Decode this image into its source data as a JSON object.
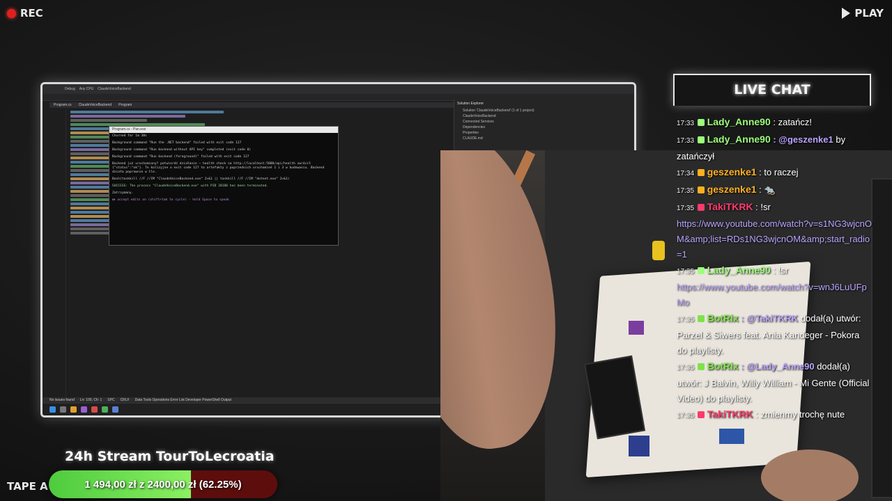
{
  "overlay": {
    "rec": "REC",
    "play": "PLAY",
    "tape": "TAPE A"
  },
  "stream": {
    "title": "24h Stream TourToLecroatia",
    "goal_text": "1 494,00 zł z 2400,00 zł (62.25%)",
    "goal_fraction": 0.6225
  },
  "ide": {
    "titlebar": [
      "Debug",
      "Any CPU",
      "ClaudeVoiceBackend"
    ],
    "tabs": [
      "Program.cs",
      "ClaudeVoiceBackend",
      "Program"
    ],
    "solution_header": "Solution Explorer",
    "solution_items": [
      "Solution 'ClaudeVoiceBackend' (1 of 1 project)",
      "ClaudeVoiceBackend",
      "Connected Services",
      "Dependencies",
      "Properties",
      "CLAUDE.md"
    ],
    "statusbar": [
      "No issues found",
      "Ln: 100, Ch: 1",
      "SPC",
      "CRLF"
    ],
    "bottom_tabs": "Data Tools Operations  Error List  Developer PowerShell  Output",
    "terminal": {
      "title": "Program.cs - Pan.exe",
      "lines": [
        "Churned for 1m 38s",
        "Background command \"Run the .NET backend\" failed with exit code 127",
        "Background command \"Run backend without API key\" completed (exit code 0)",
        "Background command \"Run backend (foreground)\" failed with exit code 127",
        "Backend już uruchomiony? potwierdź działanie — health check na http://localhost:5000/api/health zwrócił {\"status\":\"ok\"}. Te kolizyjne o exit code 127 to artefakty z poprzednich uruchomień 1 i 3 w budowaniu. Backend działa poprawnie w tle.",
        "Bash(taskkill //F //IM \"ClaudeVoiceBackend.exe\" 2>&1 || taskkill //F //IM \"dotnet.exe\" 2>&1)",
        "SUCCESS: The process \"ClaudeVoiceBackend.exe\" with PID 28180 has been terminated.",
        "Zatrzymany."
      ],
      "hint": "⏵⏵ accept edits on (shift+tab to cycle) · hold Space to speak"
    }
  },
  "chat": {
    "title": "LIVE CHAT",
    "messages": [
      {
        "time": "17:33",
        "nick": "Lady_Anne90",
        "nick_color": "#9dff7a",
        "text": ": zatańcz!"
      },
      {
        "time": "17:33",
        "nick": "Lady_Anne90",
        "nick_color": "#9dff7a",
        "mention": "@geszenke1",
        "text": " by zatańczył"
      },
      {
        "time": "17:34",
        "nick": "geszenke1",
        "nick_color": "#ffb020",
        "text": ": to raczej"
      },
      {
        "time": "17:35",
        "nick": "geszenke1",
        "nick_color": "#ffb020",
        "text": ": 🐀"
      },
      {
        "time": "17:35",
        "nick": "TakiTKRK",
        "nick_color": "#ff3a6e",
        "text": ": !sr"
      },
      {
        "link": "https://www.youtube.com/watch?v=s1NG3wjcnOM&amp;list=RDs1NG3wjcnOM&amp;start_radio=1"
      },
      {
        "time": "17:35",
        "nick": "Lady_Anne90",
        "nick_color": "#9dff7a",
        "text": ": !sr"
      },
      {
        "link": "https://www.youtube.com/watch?v=wnJ6LuUFpMo"
      },
      {
        "time": "17:35",
        "nick": "BotRix",
        "nick_color": "#7fe24a",
        "mention": "@TakiTKRK",
        "text": " dodał(a) utwór: Parzel & Siwers feat. Ania Kandeger - Pokora do playlisty."
      },
      {
        "time": "17:35",
        "nick": "BotRix",
        "nick_color": "#7fe24a",
        "mention": "@Lady_Anne90",
        "text": " dodał(a) utwór: J Balvin, Willy William - Mi Gente (Official Video) do playlisty."
      },
      {
        "time": "17:35",
        "nick": "TakiTKRK",
        "nick_color": "#ff3a6e",
        "text": ": zmienmy trochę nute"
      }
    ]
  }
}
